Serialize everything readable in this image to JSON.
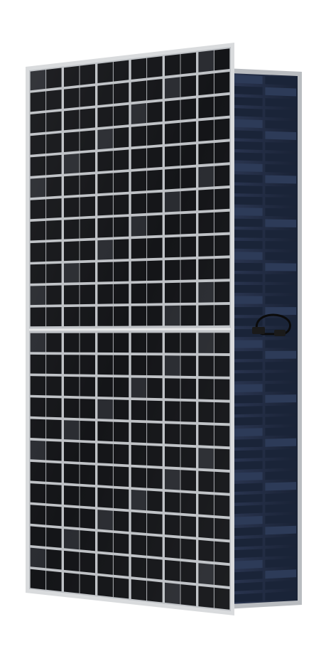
{
  "scene": {
    "subject": "bifacial-solar-panels",
    "front_panel": {
      "cell_columns": 6,
      "cell_rows_per_half": 12,
      "halves": 2,
      "colors": {
        "frame": "#d9dbdd",
        "cell": "#141518",
        "cell_highlight": "#2a2c31",
        "busbar_gap": "#bfc2c6",
        "divider": "#e6e7e8"
      }
    },
    "rear_panel": {
      "cell_columns": 2,
      "cell_rows_per_half": 24,
      "halves": 2,
      "colors": {
        "frame": "#b9bcc0",
        "cell": "#1a2438",
        "cell_highlight": "#2d3b58",
        "grid": "#c9ccd0"
      },
      "junction_box_cable": "#0b0b0b"
    },
    "background": "#ffffff"
  }
}
